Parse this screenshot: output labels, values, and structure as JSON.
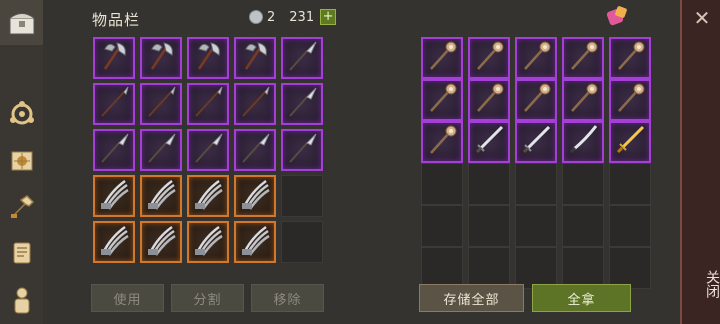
{
  "inventory": {
    "title": "物品栏",
    "currency_a": "2",
    "currency_b": "231",
    "plus_label": "+",
    "buttons": [
      "使用",
      "分割",
      "移除"
    ],
    "slots": [
      "axe",
      "axe",
      "axe",
      "axe",
      "glaive",
      "spear",
      "spear",
      "spear",
      "spear",
      "glaive",
      "glaive",
      "glaive",
      "glaive",
      "glaive",
      "glaive",
      "claw",
      "claw",
      "claw",
      "claw",
      "empty",
      "claw",
      "claw",
      "claw",
      "claw",
      "empty"
    ]
  },
  "storage": {
    "store_all_label": "存储全部",
    "take_all_label": "全拿",
    "slots": [
      "staff",
      "staff",
      "staff",
      "staff",
      "staff",
      "staff",
      "staff",
      "staff",
      "staff",
      "staff",
      "staff",
      "sword",
      "sword",
      "blade",
      "gold-sword",
      "empty",
      "empty",
      "empty",
      "empty",
      "empty",
      "empty",
      "empty",
      "empty",
      "empty",
      "empty",
      "empty",
      "empty",
      "empty",
      "empty",
      "empty"
    ]
  },
  "close_label": "关闭",
  "close_symbol": "✕",
  "colors": {
    "epic": "#a43fd6",
    "legendary": "#d1782c",
    "confirm": "#5d7426"
  },
  "sidebar_icons": [
    "chest-icon",
    "crafting-icon",
    "knowledge-icon",
    "build-icon",
    "scroll-icon",
    "character-icon"
  ]
}
